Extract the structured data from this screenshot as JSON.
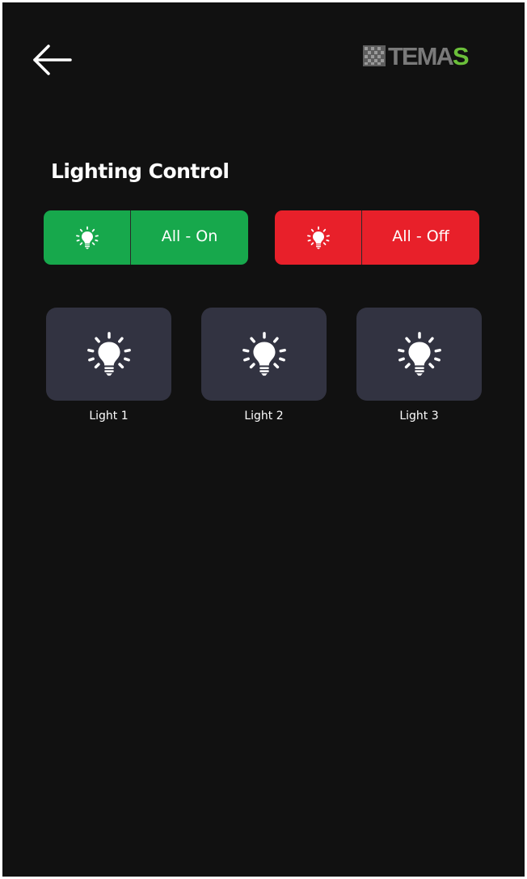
{
  "header": {
    "back_icon": "arrow-left-icon",
    "logo_text_main": "TEMA",
    "logo_text_accent": "S"
  },
  "page": {
    "title": "Lighting Control"
  },
  "controls": {
    "all_on": {
      "label": "All - On",
      "icon": "lightbulb-icon",
      "color": "#17a84c"
    },
    "all_off": {
      "label": "All - Off",
      "icon": "lightbulb-icon",
      "color": "#e8202a"
    }
  },
  "lights": [
    {
      "label": "Light 1",
      "icon": "lightbulb-icon"
    },
    {
      "label": "Light 2",
      "icon": "lightbulb-icon"
    },
    {
      "label": "Light 3",
      "icon": "lightbulb-icon"
    }
  ],
  "colors": {
    "background": "#111111",
    "tile": "#323341",
    "logo_gray": "#7a7a7a",
    "logo_green": "#6bbf3a"
  }
}
